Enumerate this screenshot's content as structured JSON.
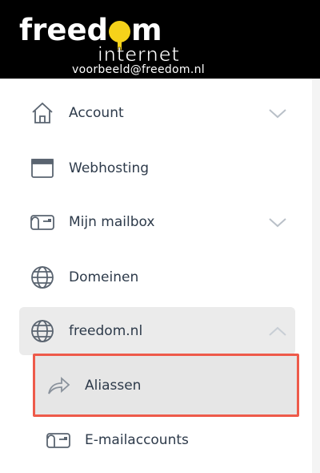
{
  "header": {
    "logo_text_before": "freed",
    "logo_text_after": "m",
    "logo_subtext": "internet",
    "account_email": "voorbeeld@freedom.nl"
  },
  "nav": {
    "items": [
      {
        "label": "Account",
        "icon": "house-icon",
        "has_chevron": true,
        "chevron": "chevron-down"
      },
      {
        "label": "Webhosting",
        "icon": "window-icon",
        "has_chevron": false
      },
      {
        "label": "Mijn mailbox",
        "icon": "mailbox-icon",
        "has_chevron": true,
        "chevron": "chevron-down"
      },
      {
        "label": "Domeinen",
        "icon": "globe-icon",
        "has_chevron": false
      },
      {
        "label": "freedom.nl",
        "icon": "globe-icon",
        "has_chevron": true,
        "chevron": "chevron-up",
        "expanded": true
      }
    ],
    "sub_items": [
      {
        "label": "Aliassen",
        "icon": "forward-arrow-icon",
        "selected": true
      },
      {
        "label": "E-mailaccounts",
        "icon": "mailbox-icon",
        "selected": false
      }
    ]
  },
  "colors": {
    "header_bg": "#000000",
    "logo_accent": "#f5d21a",
    "text": "#2d3a4a",
    "active_bg": "#ebebeb",
    "highlight_border": "#ee5a4a"
  }
}
